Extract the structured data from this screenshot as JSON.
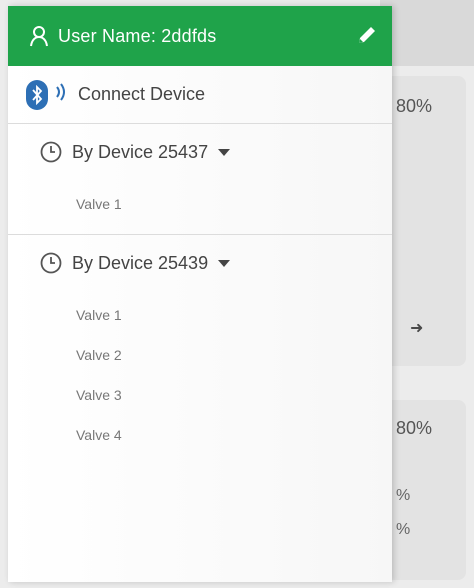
{
  "background": {
    "card1_value": "80%",
    "card2_value": "80%",
    "card2_line1": "%",
    "card2_line2": "%",
    "arrow_glyph": "➜"
  },
  "drawer": {
    "user_label": "User Name: 2ddfds",
    "connect_label": "Connect Device",
    "devices": [
      {
        "label": "By Device 25437",
        "valves": [
          "Valve 1"
        ]
      },
      {
        "label": "By Device 25439",
        "valves": [
          "Valve 1",
          "Valve 2",
          "Valve 3",
          "Valve 4"
        ]
      }
    ]
  },
  "colors": {
    "header_green": "#1fa34a",
    "bluetooth_blue": "#2d6fb5"
  },
  "icons": [
    "user-icon",
    "edit-icon",
    "bluetooth-icon",
    "clock-icon",
    "caret-down-icon",
    "arrow-right-icon"
  ]
}
